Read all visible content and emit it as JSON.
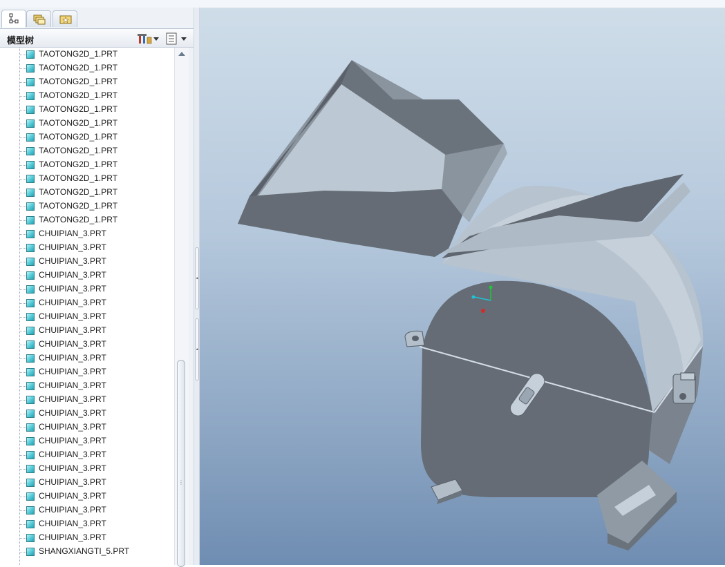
{
  "navigator": {
    "tabs": [
      {
        "name": "model-tree-tab",
        "icon": "model-tree-icon"
      },
      {
        "name": "folder-browser-tab",
        "icon": "folder-icon"
      },
      {
        "name": "favorites-tab",
        "icon": "favorites-icon"
      }
    ],
    "panel_title": "模型树",
    "settings_icon": "tree-settings-icon",
    "columns_icon": "tree-columns-icon"
  },
  "tree": {
    "items": [
      {
        "label": "TAOTONG2D_1.PRT"
      },
      {
        "label": "TAOTONG2D_1.PRT"
      },
      {
        "label": "TAOTONG2D_1.PRT"
      },
      {
        "label": "TAOTONG2D_1.PRT"
      },
      {
        "label": "TAOTONG2D_1.PRT"
      },
      {
        "label": "TAOTONG2D_1.PRT"
      },
      {
        "label": "TAOTONG2D_1.PRT"
      },
      {
        "label": "TAOTONG2D_1.PRT"
      },
      {
        "label": "TAOTONG2D_1.PRT"
      },
      {
        "label": "TAOTONG2D_1.PRT"
      },
      {
        "label": "TAOTONG2D_1.PRT"
      },
      {
        "label": "TAOTONG2D_1.PRT"
      },
      {
        "label": "TAOTONG2D_1.PRT"
      },
      {
        "label": "CHUIPIAN_3.PRT"
      },
      {
        "label": "CHUIPIAN_3.PRT"
      },
      {
        "label": "CHUIPIAN_3.PRT"
      },
      {
        "label": "CHUIPIAN_3.PRT"
      },
      {
        "label": "CHUIPIAN_3.PRT"
      },
      {
        "label": "CHUIPIAN_3.PRT"
      },
      {
        "label": "CHUIPIAN_3.PRT"
      },
      {
        "label": "CHUIPIAN_3.PRT"
      },
      {
        "label": "CHUIPIAN_3.PRT"
      },
      {
        "label": "CHUIPIAN_3.PRT"
      },
      {
        "label": "CHUIPIAN_3.PRT"
      },
      {
        "label": "CHUIPIAN_3.PRT"
      },
      {
        "label": "CHUIPIAN_3.PRT"
      },
      {
        "label": "CHUIPIAN_3.PRT"
      },
      {
        "label": "CHUIPIAN_3.PRT"
      },
      {
        "label": "CHUIPIAN_3.PRT"
      },
      {
        "label": "CHUIPIAN_3.PRT"
      },
      {
        "label": "CHUIPIAN_3.PRT"
      },
      {
        "label": "CHUIPIAN_3.PRT"
      },
      {
        "label": "CHUIPIAN_3.PRT"
      },
      {
        "label": "CHUIPIAN_3.PRT"
      },
      {
        "label": "CHUIPIAN_3.PRT"
      },
      {
        "label": "CHUIPIAN_3.PRT"
      },
      {
        "label": "SHANGXIANGTI_5.PRT"
      }
    ]
  },
  "viewport": {
    "model_icon": "hammer-crusher-model",
    "csys_icon": "coordinate-system-icon"
  },
  "colors": {
    "part_icon": "#52c9d6",
    "viewport_top": "#cfdde9",
    "viewport_bottom": "#6f8db2",
    "model_dark": "#676e77",
    "model_light": "#b9c6d3"
  }
}
